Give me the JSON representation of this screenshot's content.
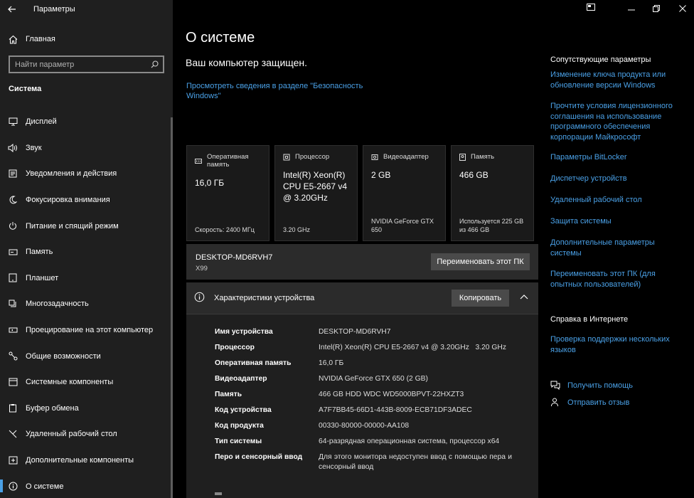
{
  "window": {
    "title": "Параметры"
  },
  "sidebar": {
    "home_label": "Главная",
    "search_placeholder": "Найти параметр",
    "section_label": "Система",
    "items": [
      {
        "label": "Дисплей",
        "icon": "monitor-icon"
      },
      {
        "label": "Звук",
        "icon": "speaker-icon"
      },
      {
        "label": "Уведомления и действия",
        "icon": "notification-icon"
      },
      {
        "label": "Фокусировка внимания",
        "icon": "moon-icon"
      },
      {
        "label": "Питание и спящий режим",
        "icon": "power-icon"
      },
      {
        "label": "Память",
        "icon": "storage-icon"
      },
      {
        "label": "Планшет",
        "icon": "tablet-icon"
      },
      {
        "label": "Многозадачность",
        "icon": "multitasking-icon"
      },
      {
        "label": "Проецирование на этот компьютер",
        "icon": "project-icon"
      },
      {
        "label": "Общие возможности",
        "icon": "share-icon"
      },
      {
        "label": "Системные компоненты",
        "icon": "components-icon"
      },
      {
        "label": "Буфер обмена",
        "icon": "clipboard-icon"
      },
      {
        "label": "Удаленный рабочий стол",
        "icon": "remote-desktop-icon"
      },
      {
        "label": "Дополнительные компоненты",
        "icon": "addons-icon"
      },
      {
        "label": "О системе",
        "icon": "info-icon",
        "active": true
      }
    ]
  },
  "main": {
    "title": "О системе",
    "protected": "Ваш компьютер защищен.",
    "security_link": "Просмотреть сведения в разделе \"Безопасность Windows\"",
    "cards": [
      {
        "label": "Оперативная память",
        "value": "16,0 ГБ",
        "sub": "Скорость: 2400 МГц",
        "icon": "ram-icon"
      },
      {
        "label": "Процессор",
        "value": "Intel(R) Xeon(R) CPU E5-2667 v4 @ 3.20GHz",
        "sub": "3.20 GHz",
        "icon": "cpu-icon"
      },
      {
        "label": "Видеоадаптер",
        "value": "2 GB",
        "sub": "NVIDIA GeForce GTX 650",
        "icon": "gpu-icon"
      },
      {
        "label": "Память",
        "value": "466 GB",
        "sub": "Используется 225 GB из 466 GB",
        "icon": "disk-icon"
      }
    ],
    "pc_name": "DESKTOP-MD6RVH7",
    "pc_model": "X99",
    "rename_button": "Переименовать этот ПК",
    "spec": {
      "title": "Характеристики устройства",
      "copy_button": "Копировать",
      "rows": [
        {
          "key": "Имя устройства",
          "value": "DESKTOP-MD6RVH7"
        },
        {
          "key": "Процессор",
          "value": "Intel(R) Xeon(R) CPU E5-2667 v4 @ 3.20GHz   3.20 GHz"
        },
        {
          "key": "Оперативная память",
          "value": "16,0 ГБ"
        },
        {
          "key": "Видеоадаптер",
          "value": "NVIDIA GeForce GTX 650 (2 GB)"
        },
        {
          "key": "Память",
          "value": "466 GB HDD WDC WD5000BPVT-22HXZT3"
        },
        {
          "key": "Код устройства",
          "value": "A7F7BB45-66D1-443B-8009-ECB71DF3ADEC"
        },
        {
          "key": "Код продукта",
          "value": "00330-80000-00000-AA108"
        },
        {
          "key": "Тип системы",
          "value": "64-разрядная операционная система, процессор x64"
        },
        {
          "key": "Перо и сенсорный ввод",
          "value": "Для этого монитора недоступен ввод с помощью пера и сенсорный ввод"
        }
      ]
    }
  },
  "right": {
    "related_heading": "Сопутствующие параметры",
    "related_links": [
      "Изменение ключа продукта или обновление версии Windows",
      "Прочтите условия лицензионного соглашения на использование программного обеспечения корпорации Майкрософт",
      "Параметры BitLocker",
      "Диспетчер устройств",
      "Удаленный рабочий стол",
      "Защита системы",
      "Дополнительные параметры системы",
      "Переименовать этот ПК (для опытных пользователей)"
    ],
    "help_heading": "Справка в Интернете",
    "help_link": "Проверка поддержки нескольких языков",
    "get_help": "Получить помощь",
    "feedback": "Отправить отзыв"
  },
  "colors": {
    "accent": "#4aa0e6",
    "sidebar_bg": "#1f1f1f",
    "card_bg": "#1a1a1a",
    "panel_bg": "#2b2b2b"
  }
}
